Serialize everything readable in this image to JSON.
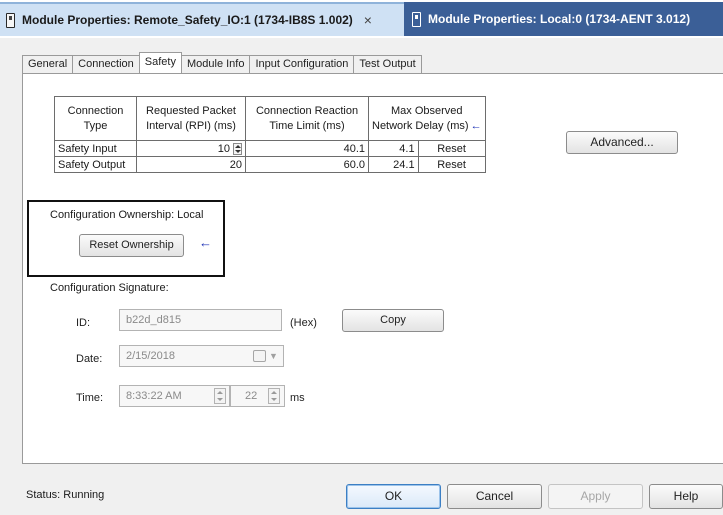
{
  "doc_tabs": [
    {
      "title": "Module Properties: Remote_Safety_IO:1 (1734-IB8S 1.002)",
      "close": "×"
    },
    {
      "title": "Module Properties: Local:0 (1734-AENT 3.012)"
    }
  ],
  "prop_tabs": [
    "General",
    "Connection",
    "Safety",
    "Module Info",
    "Input Configuration",
    "Test Output"
  ],
  "table": {
    "headers": {
      "type_l1": "Connection",
      "type_l2": "Type",
      "rpi_l1": "Requested Packet",
      "rpi_l2": "Interval (RPI) (ms)",
      "crt_l1": "Connection Reaction",
      "crt_l2": "Time Limit (ms)",
      "mond_l1": "Max Observed",
      "mond_l2": "Network Delay (ms)"
    },
    "arrow": "←",
    "rows": [
      {
        "type": "Safety Input",
        "rpi": "10",
        "crt": "40.1",
        "delay": "4.1",
        "reset": "Reset"
      },
      {
        "type": "Safety Output",
        "rpi": "20",
        "crt": "60.0",
        "delay": "24.1",
        "reset": "Reset"
      }
    ]
  },
  "advanced_label": "Advanced...",
  "ownership": {
    "label": "Configuration Ownership: Local",
    "reset_button": "Reset Ownership",
    "arrow": "←"
  },
  "signature": {
    "label": "Configuration Signature:",
    "id_label": "ID:",
    "id_value": "b22d_d815",
    "hex_label": "(Hex)",
    "copy_label": "Copy",
    "date_label": "Date:",
    "date_value": "2/15/2018",
    "time_label": "Time:",
    "time_value": "8:33:22 AM",
    "ms_value": "22",
    "ms_label": "ms"
  },
  "status_text": "Status:  Running",
  "buttons": {
    "ok": "OK",
    "cancel": "Cancel",
    "apply": "Apply",
    "help": "Help"
  },
  "icons": {
    "module": "module-icon",
    "spinner": "spinner-icon",
    "calendar": "calendar-icon",
    "arrow": "arrow-left-icon"
  },
  "colors": {
    "active_tab_bg": "#cfe1f4",
    "inactive_tab_bg": "#3b5f97",
    "arrow": "#1b2fb5",
    "highlight_border": "#111111"
  }
}
